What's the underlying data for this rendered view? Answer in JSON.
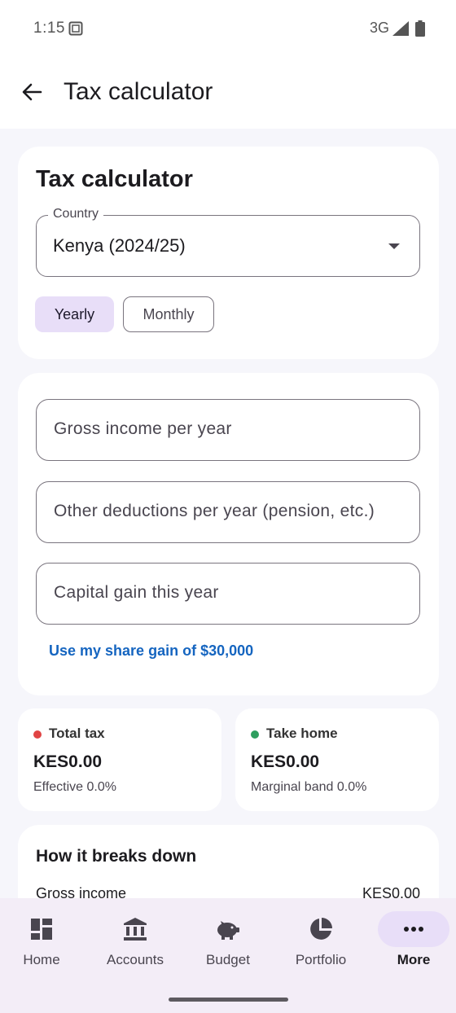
{
  "status": {
    "time": "1:15",
    "network": "3G"
  },
  "appbar": {
    "title": "Tax calculator"
  },
  "calculator": {
    "title": "Tax calculator",
    "country_label": "Country",
    "country_value": "Kenya (2024/25)",
    "period_yearly": "Yearly",
    "period_monthly": "Monthly",
    "selected_period": "Yearly"
  },
  "inputs": {
    "gross_placeholder": "Gross income per year",
    "deductions_placeholder": "Other deductions per year (pension, etc.)",
    "capital_placeholder": "Capital gain this year",
    "share_link": "Use my share gain of $30,000"
  },
  "summary": {
    "total_tax": {
      "label": "Total tax",
      "value": "KES0.00",
      "sub": "Effective 0.0%",
      "dot_color": "#e04444"
    },
    "take_home": {
      "label": "Take home",
      "value": "KES0.00",
      "sub": "Marginal band 0.0%",
      "dot_color": "#2e9e5e"
    }
  },
  "breakdown": {
    "title": "How it breaks down",
    "rows": [
      {
        "label": "Gross income",
        "value": "KES0.00"
      }
    ]
  },
  "nav": {
    "items": [
      {
        "label": "Home",
        "icon": "dashboard-icon"
      },
      {
        "label": "Accounts",
        "icon": "bank-icon"
      },
      {
        "label": "Budget",
        "icon": "piggy-bank-icon"
      },
      {
        "label": "Portfolio",
        "icon": "pie-chart-icon"
      },
      {
        "label": "More",
        "icon": "more-horizontal-icon"
      }
    ],
    "active": "More"
  },
  "colors": {
    "accent": "#e8def8",
    "link": "#1565c0",
    "background": "#f6f6fb"
  }
}
